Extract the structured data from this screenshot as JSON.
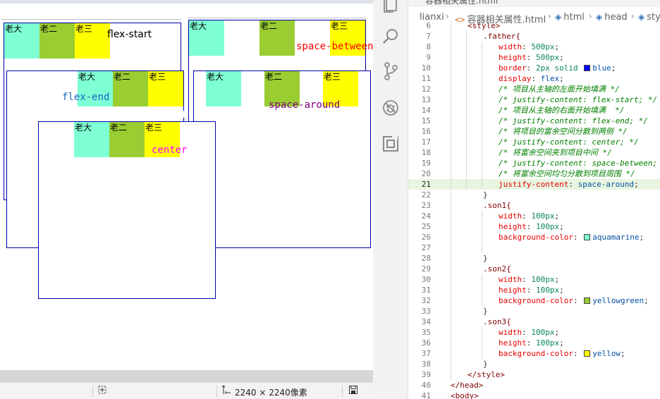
{
  "viewer": {
    "zoom_icon": "fit-icon",
    "size_icon": "dimensions-icon",
    "size_text": "2240 × 2240像素",
    "save_icon": "save-icon"
  },
  "demos": {
    "flex_start": {
      "items": [
        "老大",
        "老二",
        "老三"
      ],
      "label": "flex-start",
      "label_color": "#000000"
    },
    "space_between": {
      "items": [
        "老大",
        "老二",
        "老三"
      ],
      "label": "space-between",
      "label_color": "#ff0000"
    },
    "flex_end": {
      "items": [
        "老大",
        "老二",
        "老三"
      ],
      "label": "flex-end",
      "label_color": "#1565c0"
    },
    "space_around": {
      "items": [
        "老大",
        "老二",
        "老三"
      ],
      "label": "space-around",
      "label_color": "#800080"
    },
    "center": {
      "items": [
        "老大",
        "老二",
        "老三"
      ],
      "label": "center",
      "label_color": "#ff00ff"
    }
  },
  "activity_bar": {
    "items": [
      "explorer-icon",
      "search-icon",
      "source-control-icon",
      "run-debug-icon",
      "extensions-icon"
    ]
  },
  "editor": {
    "tab_title": "容器相关属性.html",
    "breadcrumb": [
      "lianxi",
      "容器相关属性.html",
      "html",
      "head",
      "style"
    ],
    "active_line": "21",
    "lines": [
      {
        "n": "6",
        "text": "<style>"
      },
      {
        "n": "7",
        "text": ".father{"
      },
      {
        "n": "8",
        "prop": "width",
        "val": "500px"
      },
      {
        "n": "9",
        "prop": "height",
        "val": "500px"
      },
      {
        "n": "10",
        "prop": "border",
        "val": "2px solid",
        "swatch": "#0000ff",
        "val2": "blue"
      },
      {
        "n": "11",
        "prop": "display",
        "val": "flex"
      },
      {
        "n": "12",
        "comment": "/* 项目从主轴的左面开始填满 */"
      },
      {
        "n": "13",
        "comment": "/* justify-content: flex-start; */"
      },
      {
        "n": "14",
        "comment": "/* 项目从主轴的右面开始填满  */"
      },
      {
        "n": "15",
        "comment": "/* justify-content: flex-end; */"
      },
      {
        "n": "16",
        "comment": "/* 将项目的富余空间分散到两侧 */"
      },
      {
        "n": "17",
        "comment": "/* justify-content: center; */"
      },
      {
        "n": "18",
        "comment": "/* 将富余空间夹到项目中间 */"
      },
      {
        "n": "19",
        "comment": "/* justify-content: space-between; */"
      },
      {
        "n": "20",
        "comment": "/* 将富余空间均匀分散到项目周围 */"
      },
      {
        "n": "21",
        "prop": "justify-content",
        "val": "space-around"
      },
      {
        "n": "22",
        "text": "}"
      },
      {
        "n": "23",
        "text": ".son1{"
      },
      {
        "n": "24",
        "prop": "width",
        "val": "100px"
      },
      {
        "n": "25",
        "prop": "height",
        "val": "100px"
      },
      {
        "n": "26",
        "prop": "background-color",
        "swatch": "#7fffd4",
        "val": "aquamarine"
      },
      {
        "n": "27",
        "text": ""
      },
      {
        "n": "28",
        "text": "}"
      },
      {
        "n": "29",
        "text": ".son2{"
      },
      {
        "n": "30",
        "prop": "width",
        "val": "100px"
      },
      {
        "n": "31",
        "prop": "height",
        "val": "100px"
      },
      {
        "n": "32",
        "prop": "background-color",
        "swatch": "#9acd32",
        "val": "yellowgreen"
      },
      {
        "n": "33",
        "text": "}"
      },
      {
        "n": "34",
        "text": ".son3{"
      },
      {
        "n": "35",
        "prop": "width",
        "val": "100px"
      },
      {
        "n": "36",
        "prop": "height",
        "val": "100px"
      },
      {
        "n": "37",
        "prop": "background-color",
        "swatch": "#ffff00",
        "val": "yellow"
      },
      {
        "n": "38",
        "text": "}"
      },
      {
        "n": "39",
        "text": "</style>"
      },
      {
        "n": "40",
        "text": "</head>"
      },
      {
        "n": "41",
        "text": "<body>"
      }
    ]
  },
  "colors": {
    "border": "#0000a8",
    "aqua": "#7fffd4",
    "green": "#9acd32",
    "yellow": "#ffff00"
  }
}
